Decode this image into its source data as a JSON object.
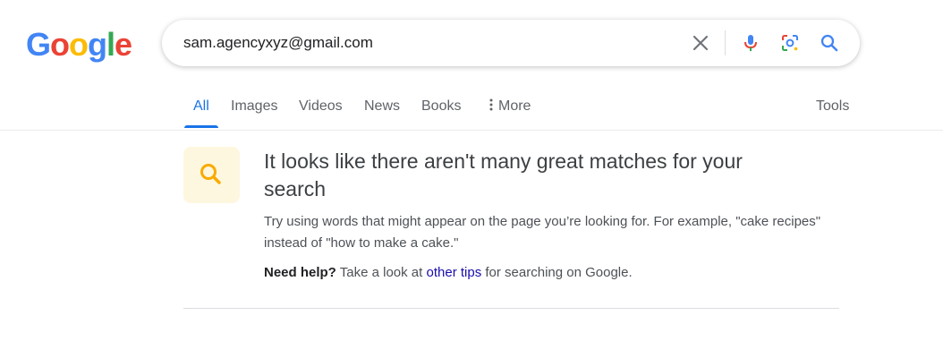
{
  "logo": {
    "letters": [
      "G",
      "o",
      "o",
      "g",
      "l",
      "e"
    ],
    "colors": [
      "#4285F4",
      "#EA4335",
      "#FBBC05",
      "#4285F4",
      "#34A853",
      "#EA4335"
    ]
  },
  "search": {
    "query": "sam.agencyxyz@gmail.com",
    "icons": [
      "clear-icon",
      "microphone-icon",
      "lens-icon",
      "search-icon"
    ]
  },
  "tabs": {
    "items": [
      {
        "label": "All",
        "active": true
      },
      {
        "label": "Images"
      },
      {
        "label": "Videos"
      },
      {
        "label": "News"
      },
      {
        "label": "Books"
      },
      {
        "label": "More",
        "icon": "more-vert-icon"
      }
    ],
    "tools_label": "Tools"
  },
  "result": {
    "icon": "search-icon",
    "headline": "It looks like there aren't many great matches for your search",
    "tip": "Try using words that might appear on the page you’re looking for. For example, \"cake recipes\" instead of \"how to make a cake.\"",
    "help_bold": "Need help?",
    "help_pre": "Take a look at",
    "help_link": "other tips",
    "help_post": "for searching on Google."
  },
  "colors": {
    "accent": "#1a73e8",
    "link": "#1a0dab",
    "tile_bg": "#fef7e0",
    "tile_icon": "#f9ab00"
  }
}
